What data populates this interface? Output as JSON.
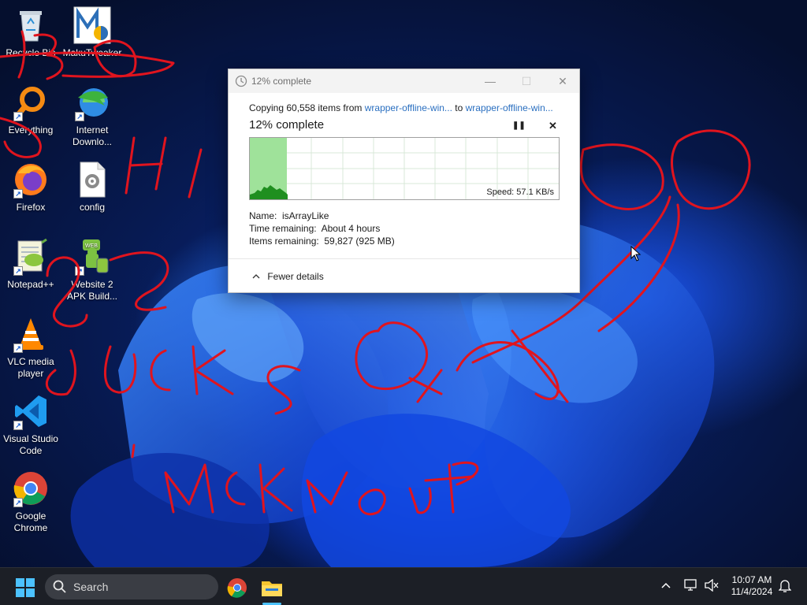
{
  "desktop": {
    "icons": [
      {
        "label": "Recycle Bin",
        "icon": "recycle-bin-icon"
      },
      {
        "label": "MakuTweaker",
        "icon": "makutweaker-icon"
      },
      {
        "label": "Everything",
        "icon": "everything-search-icon"
      },
      {
        "label": "Internet Downlo...",
        "icon": "internet-download-manager-icon"
      },
      {
        "label": "Firefox",
        "icon": "firefox-icon"
      },
      {
        "label": "config",
        "icon": "config-file-icon"
      },
      {
        "label": "Notepad++",
        "icon": "notepad-plus-plus-icon"
      },
      {
        "label": "Website 2 APK Build...",
        "icon": "website2apk-icon"
      },
      {
        "label": "VLC media player",
        "icon": "vlc-icon"
      },
      {
        "label": "Visual Studio Code",
        "icon": "vscode-icon"
      },
      {
        "label": "Google Chrome",
        "icon": "chrome-icon"
      }
    ]
  },
  "copy_dialog": {
    "title": "12% complete",
    "copy_prefix": "Copying 60,558 items from ",
    "source": "wrapper-offline-win...",
    "to_word": " to ",
    "destination": "wrapper-offline-win...",
    "percent_title": "12% complete",
    "progress_percent": 12,
    "speed": "Speed: 57.1 KB/s",
    "name_label": "Name:",
    "name_value": "isArrayLike",
    "time_label": "Time remaining:",
    "time_value": "About 4 hours",
    "items_label": "Items remaining:",
    "items_value": "59,827 (925 MB)",
    "fewer_details": "Fewer details",
    "minimize": "—",
    "maximize": "☐",
    "close": "✕",
    "pause": "❚❚",
    "cancel": "✕"
  },
  "taskbar": {
    "search_placeholder": "Search",
    "time": "10:07 AM",
    "date": "11/4/2024"
  },
  "colors": {
    "progress_fill": "#9fe29a",
    "progress_line": "#1e8a1e",
    "link": "#2a6fc0",
    "scribble": "#e0141e"
  }
}
